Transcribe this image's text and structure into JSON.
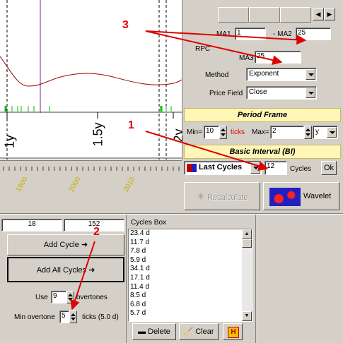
{
  "chart": {
    "axis_labels": [
      "1y",
      "1.5y",
      "2y"
    ],
    "year_labels": [
      "1990",
      "2000",
      "2010"
    ]
  },
  "ma": {
    "ma1_label": "MA1",
    "ma1_value": "1",
    "ma2_label": "- MA2",
    "ma2_value": "25",
    "rpc_label": "RPC",
    "ma3_label": "MA3",
    "ma3_value": "25",
    "method_label": "Method",
    "method_value": "Exponent",
    "price_field_label": "Price Field",
    "price_field_value": "Close"
  },
  "period_frame": {
    "title": "Period Frame",
    "min_label": "Min=",
    "min_value": "10",
    "ticks_label": "ticks",
    "max_label": "Max=",
    "max_value": "2",
    "unit_value": "y"
  },
  "basic_interval": {
    "title": "Basic Interval (BI)",
    "mode_value": "Last Cycles",
    "count_value": "12",
    "cycles_label": "Cycles",
    "ok_label": "Ok"
  },
  "buttons": {
    "recalculate": "Recalculate",
    "wavelet": "Wavelet",
    "add_cycle": "Add Cycle",
    "add_all_cycles": "Add All Cycles",
    "delete": "Delete",
    "clear": "Clear"
  },
  "left_panel": {
    "range_start": "18",
    "range_end": "152",
    "use_label": "Use",
    "use_value": "9",
    "overtones_label": "overtones",
    "min_overtone_label": "Min overtone",
    "min_overtone_value": "5",
    "ticks_info": "ticks (5.0 d)"
  },
  "cycles_box": {
    "title": "Cycles Box",
    "items": [
      "23.4 d",
      "11.7 d",
      "7.8 d",
      "5.9 d",
      "34.1 d",
      "17.1 d",
      "11.4 d",
      "8.5 d",
      "6.8 d",
      "5.7 d"
    ]
  },
  "annotations": {
    "one": "1",
    "two": "2",
    "three": "3"
  },
  "colors": {
    "annotation_red": "#e00000",
    "header_yellow": "#fff6b8",
    "wavelet_blue": "#2020c0"
  }
}
